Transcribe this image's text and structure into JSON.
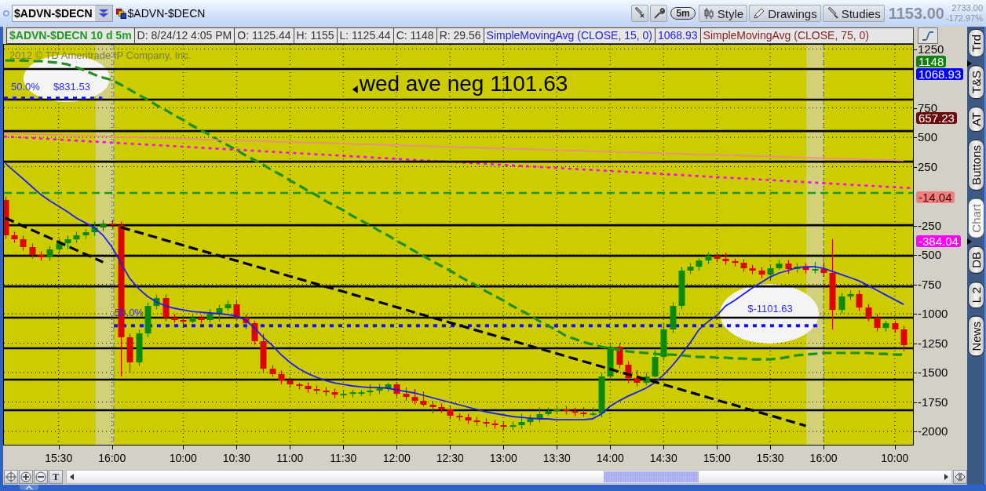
{
  "toolbar": {
    "symbol": "$ADVN-$DECN",
    "linked_symbol": "$ADVN-$DECN",
    "buttons": [
      {
        "kind": "period",
        "label": "5m"
      },
      {
        "kind": "style",
        "label": "Style"
      },
      {
        "kind": "drawings",
        "label": "Drawings"
      },
      {
        "kind": "studies",
        "label": "Studies"
      }
    ],
    "last_price": "1153.00",
    "net_change": "2733.00",
    "percent_change": "-172.97%"
  },
  "info_bar": [
    {
      "kind": "symbol",
      "text": "$ADVN-$DECN 10 d 5m",
      "color": "#1f9a1f"
    },
    {
      "kind": "date",
      "text": "D: 8/24/12 4:05 PM",
      "color": "#333333"
    },
    {
      "kind": "open",
      "text": "O: 1125.44",
      "color": "#333333"
    },
    {
      "kind": "high",
      "text": "H: 1155",
      "color": "#333333"
    },
    {
      "kind": "low",
      "text": "L: 1125.44",
      "color": "#333333"
    },
    {
      "kind": "close",
      "text": "C: 1148",
      "color": "#333333"
    },
    {
      "kind": "range",
      "text": "R: 29.56",
      "color": "#333333"
    },
    {
      "kind": "study",
      "text": "SimpleMovingAvg (CLOSE, 15, 0)",
      "color": "#2020e8"
    },
    {
      "kind": "study_value",
      "text": "1068.93",
      "color": "#2020e8"
    },
    {
      "kind": "study",
      "text": "SimpleMovingAvg (CLOSE, 75, 0)",
      "color": "#8b1a1a"
    }
  ],
  "chart": {
    "copyright": "2012 © TD Ameritrade IP Company, Inc.",
    "price_tags": [
      {
        "text": "1148",
        "color": "#128012"
      },
      {
        "text": "1068.93",
        "color": "#0000ff"
      },
      {
        "text": "657.23",
        "color": "#6b0d0d"
      },
      {
        "text": "-14.04",
        "color": "#f08080"
      },
      {
        "text": "-384.04",
        "color": "#ff00ff"
      }
    ],
    "chart_data": {
      "type": "candlestick",
      "categories": [
        null,
        null,
        null,
        null,
        null,
        null,
        "15:30",
        null,
        null,
        null,
        null,
        null,
        "16:00",
        null,
        null,
        null,
        null,
        null,
        null,
        null,
        "10:00",
        null,
        null,
        null,
        null,
        null,
        "10:30",
        null,
        null,
        null,
        null,
        null,
        "11:00",
        null,
        null,
        null,
        null,
        null,
        "11:30",
        null,
        null,
        null,
        null,
        null,
        "12:00",
        null,
        null,
        null,
        null,
        null,
        "12:30",
        null,
        null,
        null,
        null,
        null,
        "13:00",
        null,
        null,
        null,
        null,
        null,
        "13:30",
        null,
        null,
        null,
        null,
        null,
        "14:00",
        null,
        null,
        null,
        null,
        null,
        "14:30",
        null,
        null,
        null,
        null,
        null,
        "15:00",
        null,
        null,
        null,
        null,
        null,
        "15:30",
        null,
        null,
        null,
        null,
        null,
        "16:00",
        null,
        null,
        null,
        null,
        null,
        null,
        null,
        "10:00",
        null
      ],
      "ylim": [
        -2113,
        1287
      ],
      "yticks": [
        1250,
        750,
        500,
        250,
        -250,
        -500,
        -750,
        -1000,
        -1250,
        -1500,
        -1750,
        -2000
      ],
      "grid": true,
      "ohlc": [
        [
          -33,
          -3,
          -363,
          -333
        ],
        [
          -333,
          -303,
          -397,
          -367
        ],
        [
          -367,
          -337,
          -463,
          -433
        ],
        [
          -433,
          -403,
          -530,
          -500
        ],
        [
          -500,
          -470,
          -550,
          -520
        ],
        [
          -520,
          -423,
          -550,
          -453
        ],
        [
          -453,
          -360,
          -483,
          -400
        ],
        [
          -400,
          -337,
          -450,
          -367
        ],
        [
          -367,
          -303,
          -397,
          -333
        ],
        [
          -333,
          -277,
          -363,
          -307
        ],
        [
          -307,
          -215,
          -337,
          -267
        ],
        [
          -267,
          -203,
          -297,
          -233
        ],
        [
          -233,
          -203,
          -277,
          -247
        ],
        [
          -247,
          -217,
          -1533,
          -1200
        ],
        [
          -1200,
          -1170,
          -1500,
          -1413
        ],
        [
          -1413,
          -1137,
          -1443,
          -1167
        ],
        [
          -1167,
          -903,
          -1197,
          -933
        ],
        [
          -933,
          -837,
          -963,
          -867
        ],
        [
          -867,
          -837,
          -1063,
          -1033
        ],
        [
          -1033,
          -1003,
          -1075,
          -1053
        ],
        [
          -1053,
          -1023,
          -1080,
          -1067
        ],
        [
          -1067,
          -1003,
          -1080,
          -1033
        ],
        [
          -1033,
          -1010,
          -1078,
          -1053
        ],
        [
          -1053,
          -960,
          -1075,
          -1000
        ],
        [
          -1000,
          -923,
          -1067,
          -953
        ],
        [
          -953,
          -890,
          -975,
          -920
        ],
        [
          -920,
          -890,
          -1063,
          -1033
        ],
        [
          -1033,
          -1003,
          -1130,
          -1080
        ],
        [
          -1080,
          -1060,
          -1263,
          -1233
        ],
        [
          -1233,
          -1170,
          -1497,
          -1467
        ],
        [
          -1467,
          -1437,
          -1535,
          -1513
        ],
        [
          -1513,
          -1483,
          -1597,
          -1567
        ],
        [
          -1567,
          -1537,
          -1630,
          -1600
        ],
        [
          -1600,
          -1585,
          -1643,
          -1613
        ],
        [
          -1613,
          -1583,
          -1670,
          -1640
        ],
        [
          -1640,
          -1610,
          -1683,
          -1653
        ],
        [
          -1653,
          -1623,
          -1697,
          -1667
        ],
        [
          -1667,
          -1637,
          -1717,
          -1687
        ],
        [
          -1687,
          -1650,
          -1717,
          -1680
        ],
        [
          -1680,
          -1645,
          -1710,
          -1667
        ],
        [
          -1667,
          -1650,
          -1697,
          -1667
        ],
        [
          -1667,
          -1598,
          -1697,
          -1653
        ],
        [
          -1653,
          -1595,
          -1683,
          -1633
        ],
        [
          -1633,
          -1585,
          -1663,
          -1600
        ],
        [
          -1600,
          -1585,
          -1710,
          -1680
        ],
        [
          -1680,
          -1625,
          -1737,
          -1707
        ],
        [
          -1707,
          -1640,
          -1770,
          -1740
        ],
        [
          -1740,
          -1660,
          -1790,
          -1773
        ],
        [
          -1773,
          -1743,
          -1845,
          -1793
        ],
        [
          -1793,
          -1763,
          -1843,
          -1813
        ],
        [
          -1813,
          -1783,
          -1897,
          -1867
        ],
        [
          -1867,
          -1845,
          -1910,
          -1880
        ],
        [
          -1880,
          -1850,
          -1937,
          -1907
        ],
        [
          -1907,
          -1877,
          -1950,
          -1920
        ],
        [
          -1920,
          -1890,
          -1963,
          -1933
        ],
        [
          -1933,
          -1903,
          -1977,
          -1947
        ],
        [
          -1947,
          -1917,
          -1990,
          -1960
        ],
        [
          -1960,
          -1917,
          -1990,
          -1947
        ],
        [
          -1947,
          -1850,
          -1977,
          -1920
        ],
        [
          -1920,
          -1855,
          -1950,
          -1893
        ],
        [
          -1893,
          -1795,
          -1923,
          -1853
        ],
        [
          -1853,
          -1797,
          -1865,
          -1827
        ],
        [
          -1827,
          -1783,
          -1857,
          -1813
        ],
        [
          -1813,
          -1783,
          -1857,
          -1827
        ],
        [
          -1827,
          -1797,
          -1870,
          -1840
        ],
        [
          -1840,
          -1795,
          -1875,
          -1853
        ],
        [
          -1853,
          -1795,
          -1870,
          -1847
        ],
        [
          -1847,
          -1503,
          -1880,
          -1533
        ],
        [
          -1533,
          -1250,
          -1563,
          -1280
        ],
        [
          -1280,
          -1250,
          -1463,
          -1433
        ],
        [
          -1433,
          -1403,
          -1590,
          -1547
        ],
        [
          -1547,
          -1480,
          -1617,
          -1587
        ],
        [
          -1587,
          -1503,
          -1605,
          -1533
        ],
        [
          -1533,
          -1310,
          -1540,
          -1367
        ],
        [
          -1367,
          -1075,
          -1397,
          -1133
        ],
        [
          -1133,
          -903,
          -1163,
          -933
        ],
        [
          -933,
          -603,
          -963,
          -633
        ],
        [
          -633,
          -570,
          -663,
          -600
        ],
        [
          -600,
          -530,
          -630,
          -547
        ],
        [
          -547,
          -477,
          -577,
          -507
        ],
        [
          -507,
          -477,
          -563,
          -533
        ],
        [
          -533,
          -480,
          -583,
          -553
        ],
        [
          -553,
          -532,
          -597,
          -567
        ],
        [
          -567,
          -537,
          -643,
          -613
        ],
        [
          -613,
          -583,
          -663,
          -633
        ],
        [
          -633,
          -603,
          -697,
          -667
        ],
        [
          -667,
          -583,
          -715,
          -613
        ],
        [
          -613,
          -543,
          -625,
          -573
        ],
        [
          -573,
          -543,
          -660,
          -620
        ],
        [
          -620,
          -570,
          -650,
          -600
        ],
        [
          -600,
          -570,
          -657,
          -627
        ],
        [
          -627,
          -560,
          -657,
          -620
        ],
        [
          -620,
          -560,
          -683,
          -653
        ],
        [
          -653,
          -367,
          -1133,
          -967
        ],
        [
          -967,
          -823,
          -997,
          -853
        ],
        [
          -853,
          -803,
          -883,
          -833
        ],
        [
          -833,
          -803,
          -977,
          -947
        ],
        [
          -947,
          -917,
          -1063,
          -1033
        ],
        [
          -1033,
          -1003,
          -1150,
          -1120
        ],
        [
          -1120,
          -1060,
          -1150,
          -1080
        ],
        [
          -1080,
          -1060,
          -1163,
          -1133
        ],
        [
          -1133,
          -1103,
          -1320,
          -1267
        ]
      ],
      "series": [
        {
          "type": "line",
          "color": "#1a1aff",
          "values": [
            280,
            213,
            147,
            80,
            13,
            -40,
            -87,
            -133,
            -187,
            -227,
            -267,
            -333,
            -433,
            -567,
            -700,
            -787,
            -853,
            -900,
            -933,
            -953,
            -967,
            -980,
            -987,
            -993,
            -1000,
            -1007,
            -1020,
            -1053,
            -1120,
            -1200,
            -1267,
            -1347,
            -1413,
            -1467,
            -1507,
            -1540,
            -1567,
            -1587,
            -1600,
            -1613,
            -1620,
            -1627,
            -1627,
            -1633,
            -1647,
            -1660,
            -1673,
            -1693,
            -1713,
            -1733,
            -1753,
            -1773,
            -1793,
            -1813,
            -1833,
            -1847,
            -1860,
            -1873,
            -1880,
            -1887,
            -1893,
            -1893,
            -1900,
            -1900,
            -1900,
            -1900,
            -1893,
            -1853,
            -1787,
            -1740,
            -1700,
            -1667,
            -1633,
            -1587,
            -1520,
            -1440,
            -1347,
            -1247,
            -1133,
            -1067,
            -1013,
            -933,
            -887,
            -833,
            -780,
            -733,
            -687,
            -653,
            -633,
            -607,
            -600,
            -600,
            -613,
            -640,
            -667,
            -693,
            -720,
            -760,
            -800,
            -840,
            -880,
            -920
          ]
        },
        {
          "type": "line",
          "color": "#1f8f1f",
          "line_style": "dashed",
          "values": [
            1153,
            1153,
            1153,
            1147,
            1147,
            1140,
            1133,
            1120,
            1093,
            1067,
            1033,
            1007,
            987,
            947,
            904,
            860,
            820,
            773,
            733,
            687,
            647,
            600,
            560,
            520,
            473,
            433,
            393,
            347,
            307,
            267,
            220,
            180,
            133,
            93,
            47,
            7,
            -40,
            -80,
            -120,
            -167,
            -207,
            -247,
            -293,
            -333,
            -380,
            -420,
            -467,
            -507,
            -553,
            -593,
            -633,
            -680,
            -720,
            -760,
            -807,
            -847,
            -887,
            -933,
            -973,
            -1013,
            -1060,
            -1100,
            -1140,
            -1187,
            -1213,
            -1240,
            -1260,
            -1280,
            -1293,
            -1307,
            -1320,
            -1327,
            -1333,
            -1340,
            -1347,
            -1347,
            -1353,
            -1360,
            -1367,
            -1367,
            -1373,
            -1373,
            -1380,
            -1380,
            -1387,
            -1387,
            -1387,
            -1380,
            -1367,
            -1353,
            -1347,
            -1340,
            -1333,
            -1333,
            -1333,
            -1333,
            -1333,
            -1333,
            -1340,
            -1340,
            -1347,
            -1347
          ]
        },
        {
          "type": "line",
          "color": "#f08c8c",
          "values": [
            533,
            530,
            528,
            526,
            524,
            521,
            519,
            517,
            514,
            512,
            510,
            508,
            505,
            503,
            501,
            499,
            496,
            494,
            492,
            489,
            487,
            485,
            483,
            480,
            478,
            476,
            473,
            471,
            469,
            467,
            464,
            462,
            460,
            457,
            455,
            453,
            451,
            448,
            446,
            444,
            441,
            439,
            437,
            435,
            432,
            430,
            428,
            426,
            423,
            421,
            419,
            416,
            414,
            412,
            410,
            407,
            405,
            403,
            400,
            398,
            396,
            394,
            391,
            389,
            387,
            385,
            382,
            380,
            378,
            375,
            373,
            371,
            369,
            366,
            364,
            362,
            359,
            357,
            355,
            353,
            350,
            348,
            346,
            343,
            341,
            339,
            337,
            334,
            332,
            330,
            327,
            325,
            323,
            321,
            318,
            316,
            314,
            311,
            309,
            307,
            305,
            302
          ]
        },
        {
          "type": "line",
          "color": "#000000",
          "line_style": "dashed",
          "values": [
            -185,
            -219,
            -254,
            -288,
            -322,
            -356,
            -390,
            -425,
            -459,
            -493,
            -527,
            -561,
            null,
            null,
            null,
            null,
            null,
            null,
            null,
            null,
            null,
            null,
            null,
            null,
            null,
            null,
            null,
            null,
            null,
            null,
            null,
            null,
            null,
            null,
            null,
            null,
            null,
            null,
            null,
            null,
            null,
            null,
            null,
            null,
            null,
            null,
            null,
            null,
            null,
            null,
            null,
            null,
            null,
            null,
            null,
            null,
            null,
            null,
            null,
            null,
            null,
            null,
            null,
            null,
            null,
            null,
            null,
            null,
            null,
            null,
            null,
            null,
            null,
            null,
            null,
            null,
            null,
            null,
            null,
            null,
            null,
            null,
            null,
            null,
            null,
            null,
            null,
            null,
            null,
            null,
            null,
            null,
            null,
            null,
            null,
            null,
            null,
            null,
            null,
            null,
            null,
            null
          ]
        },
        {
          "type": "line",
          "color": "#000000",
          "line_style": "dashed",
          "values": [
            null,
            null,
            null,
            null,
            null,
            null,
            null,
            null,
            null,
            null,
            null,
            null,
            null,
            -265,
            -287,
            -308,
            -330,
            -352,
            -374,
            -396,
            -418,
            -440,
            -462,
            -484,
            -506,
            -528,
            -549,
            -571,
            -593,
            -615,
            -637,
            -659,
            -681,
            -703,
            -725,
            -747,
            -769,
            -790,
            -812,
            -834,
            -856,
            -878,
            -900,
            -922,
            -944,
            -966,
            -988,
            -1010,
            -1032,
            -1053,
            -1075,
            -1097,
            -1119,
            -1141,
            -1163,
            -1185,
            -1207,
            -1229,
            -1251,
            -1273,
            -1294,
            -1316,
            -1338,
            -1360,
            -1382,
            -1404,
            -1426,
            -1448,
            -1470,
            -1492,
            -1514,
            -1535,
            -1557,
            -1579,
            -1601,
            -1623,
            -1645,
            -1667,
            -1689,
            -1711,
            -1733,
            -1755,
            -1776,
            -1798,
            -1820,
            -1842,
            -1864,
            -1886,
            -1908,
            -1930,
            -1952,
            null,
            null,
            null,
            null,
            null,
            null,
            null,
            null,
            null,
            null,
            null
          ]
        }
      ],
      "ref_lines": [
        {
          "axis": "y",
          "value": 1080,
          "color": "#000000"
        },
        {
          "axis": "y",
          "value": 820,
          "color": "#000000"
        },
        {
          "axis": "y",
          "value": 553,
          "color": "#000000"
        },
        {
          "axis": "y",
          "value": 293,
          "color": "#000000"
        },
        {
          "axis": "y",
          "value": -247,
          "color": "#000000"
        },
        {
          "axis": "y",
          "value": -507,
          "color": "#000000"
        },
        {
          "axis": "y",
          "value": -767,
          "color": "#000000"
        },
        {
          "axis": "y",
          "value": -1033,
          "color": "#000000"
        },
        {
          "axis": "y",
          "value": -1293,
          "color": "#000000"
        },
        {
          "axis": "y",
          "value": -1560,
          "color": "#000000"
        },
        {
          "axis": "y",
          "value": -1820,
          "color": "#000000"
        },
        {
          "axis": "y",
          "value": 27,
          "color": "#1f9a1f",
          "line_style": "dashed"
        },
        {
          "axis": "y",
          "value": 831.53,
          "color": "#1010ff",
          "line_style": "dotted"
        },
        {
          "axis": "y",
          "value": -1101.63,
          "color": "#1010ff",
          "line_style": "dotted"
        }
      ],
      "annotations": [
        "wed ave neg 1101.63",
        "50.0%",
        "$831.53",
        "50.0%",
        "$-1101.63"
      ]
    }
  },
  "side_tabs": [
    {
      "label": "Trd",
      "selected": false
    },
    {
      "label": "T&S",
      "selected": false
    },
    {
      "label": "AT",
      "selected": false
    },
    {
      "label": "Buttons",
      "selected": false
    },
    {
      "label": "Chart",
      "selected": true
    },
    {
      "label": "DB",
      "selected": false
    },
    {
      "label": "L 2",
      "selected": false
    },
    {
      "label": "News",
      "selected": false
    }
  ],
  "bottom_bar": {
    "text_tool": "T"
  }
}
